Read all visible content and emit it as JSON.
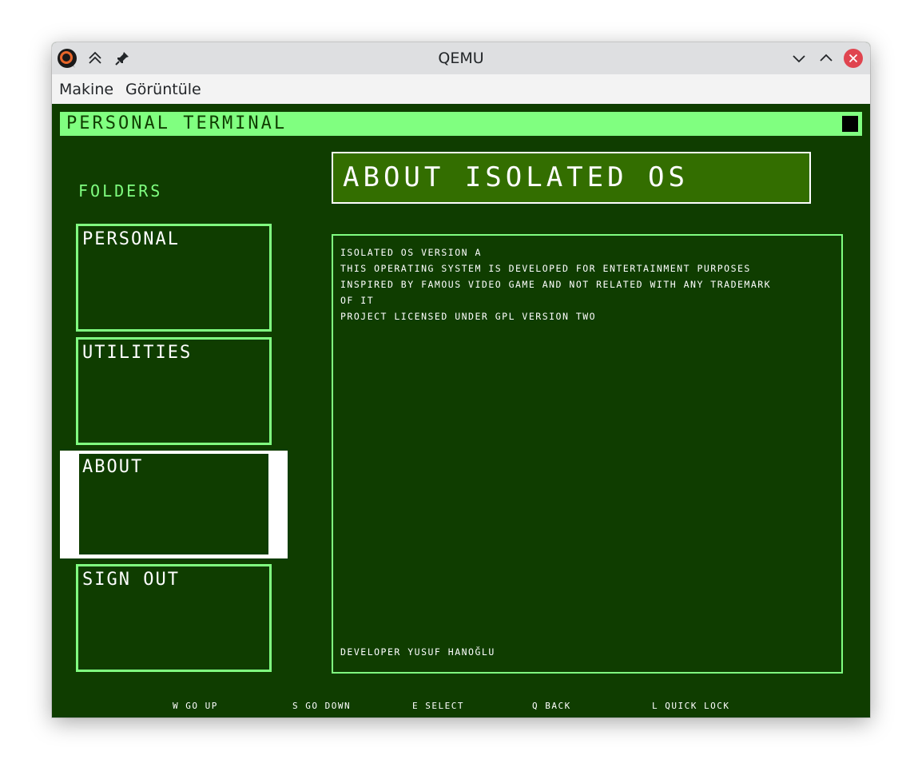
{
  "window": {
    "title": "QEMU",
    "menu": [
      "Makine",
      "Görüntüle"
    ]
  },
  "terminal": {
    "header": "PERSONAL TERMINAL",
    "folders_heading": "FOLDERS",
    "folders": [
      {
        "label": "PERSONAL",
        "selected": false
      },
      {
        "label": "UTILITIES",
        "selected": false
      },
      {
        "label": "ABOUT",
        "selected": true
      },
      {
        "label": "SIGN OUT",
        "selected": false
      }
    ],
    "page_title": "ABOUT ISOLATED OS",
    "content_lines": [
      "ISOLATED OS VERSION A",
      "THIS OPERATING SYSTEM IS DEVELOPED FOR ENTERTAINMENT PURPOSES",
      "INSPIRED BY FAMOUS VIDEO GAME AND NOT RELATED WITH ANY TRADEMARK",
      "OF IT",
      "PROJECT LICENSED UNDER GPL VERSION TWO"
    ],
    "footer_line": "DEVELOPER YUSUF HANOĞLU",
    "hints": [
      "W GO UP",
      "S GO DOWN",
      "E SELECT",
      "Q BACK",
      "L QUICK LOCK"
    ]
  },
  "colors": {
    "screen_bg": "#0f3d00",
    "accent_green": "#80ff80",
    "title_bg": "#336e00",
    "close_red": "#e0444f"
  },
  "icons": {
    "app": "qemu-logo-icon",
    "keep_above": "keep-above-icon",
    "pin": "pin-icon",
    "minimize": "chevron-down-icon",
    "maximize": "chevron-up-icon",
    "close": "close-icon"
  }
}
